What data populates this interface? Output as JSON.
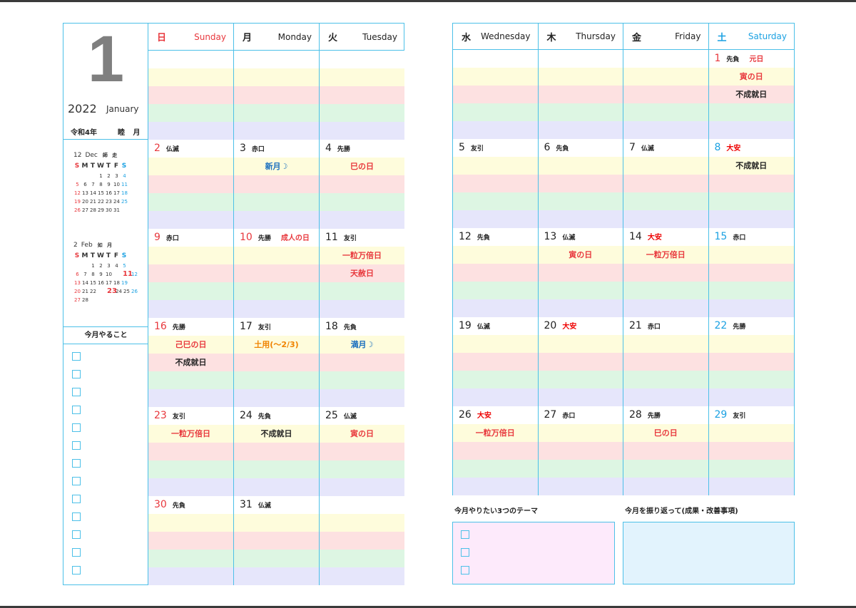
{
  "month_number": "1",
  "year": "2022",
  "month_en": "January",
  "wareki_year": "令和4年",
  "old_month_name": "睦 月",
  "dow": [
    {
      "jp": "日",
      "en": "Sunday"
    },
    {
      "jp": "月",
      "en": "Monday"
    },
    {
      "jp": "火",
      "en": "Tuesday"
    },
    {
      "jp": "水",
      "en": "Wednesday"
    },
    {
      "jp": "木",
      "en": "Thursday"
    },
    {
      "jp": "金",
      "en": "Friday"
    },
    {
      "jp": "土",
      "en": "Saturday"
    }
  ],
  "mini_calendars": [
    {
      "num": "12",
      "abbr": "Dec",
      "old_name": "師 走",
      "dow_letters": [
        "S",
        "M",
        "T",
        "W",
        "T",
        "F",
        "S"
      ],
      "weeks": [
        [
          "",
          "",
          "",
          "1",
          "2",
          "3",
          "4"
        ],
        [
          "5",
          "6",
          "7",
          "8",
          "9",
          "10",
          "11"
        ],
        [
          "12",
          "13",
          "14",
          "15",
          "16",
          "17",
          "18"
        ],
        [
          "19",
          "20",
          "21",
          "22",
          "23",
          "24",
          "25"
        ],
        [
          "26",
          "27",
          "28",
          "29",
          "30",
          "31",
          ""
        ]
      ],
      "holidays": []
    },
    {
      "num": "2",
      "abbr": "Feb",
      "old_name": "如 月",
      "dow_letters": [
        "S",
        "M",
        "T",
        "W",
        "T",
        "F",
        "S"
      ],
      "weeks": [
        [
          "",
          "",
          "1",
          "2",
          "3",
          "4",
          "5"
        ],
        [
          "6",
          "7",
          "8",
          "9",
          "10",
          "11",
          "12"
        ],
        [
          "13",
          "14",
          "15",
          "16",
          "17",
          "18",
          "19"
        ],
        [
          "20",
          "21",
          "22",
          "23",
          "24",
          "25",
          "26"
        ],
        [
          "27",
          "28",
          "",
          "",
          "",
          "",
          ""
        ]
      ],
      "holidays": [
        "11",
        "23"
      ]
    }
  ],
  "todo_title": "今月やること",
  "todo_count": 13,
  "left_weeks": [
    [
      {
        "num": "",
        "rokuyo": "",
        "holiday": "",
        "events": []
      },
      {
        "num": "",
        "rokuyo": "",
        "holiday": "",
        "events": []
      },
      {
        "num": "",
        "rokuyo": "",
        "holiday": "",
        "events": []
      }
    ],
    [
      {
        "num": "2",
        "rokuyo": "仏滅",
        "holiday": "",
        "events": []
      },
      {
        "num": "3",
        "rokuyo": "赤口",
        "holiday": "",
        "events": [
          {
            "text": "新月☽",
            "color": "blue"
          }
        ]
      },
      {
        "num": "4",
        "rokuyo": "先勝",
        "holiday": "",
        "events": [
          {
            "text": "巳の日",
            "color": "red"
          }
        ]
      }
    ],
    [
      {
        "num": "9",
        "rokuyo": "赤口",
        "holiday": "",
        "events": []
      },
      {
        "num": "10",
        "rokuyo": "先勝",
        "holiday": "成人の日",
        "events": []
      },
      {
        "num": "11",
        "rokuyo": "友引",
        "holiday": "",
        "events": [
          {
            "text": "一粒万倍日",
            "color": "red"
          },
          {
            "text": "天赦日",
            "color": "red"
          }
        ]
      }
    ],
    [
      {
        "num": "16",
        "rokuyo": "先勝",
        "holiday": "",
        "events": [
          {
            "text": "己巳の日",
            "color": "red"
          },
          {
            "text": "不成就日",
            "color": "black"
          }
        ]
      },
      {
        "num": "17",
        "rokuyo": "友引",
        "holiday": "",
        "events": [
          {
            "text": "土用(～2/3)",
            "color": "orange"
          }
        ]
      },
      {
        "num": "18",
        "rokuyo": "先負",
        "holiday": "",
        "events": [
          {
            "text": "満月☽",
            "color": "blue"
          }
        ]
      }
    ],
    [
      {
        "num": "23",
        "rokuyo": "友引",
        "holiday": "",
        "events": [
          {
            "text": "一粒万倍日",
            "color": "red"
          }
        ]
      },
      {
        "num": "24",
        "rokuyo": "先負",
        "holiday": "",
        "events": [
          {
            "text": "不成就日",
            "color": "black"
          }
        ]
      },
      {
        "num": "25",
        "rokuyo": "仏滅",
        "holiday": "",
        "events": [
          {
            "text": "寅の日",
            "color": "red"
          }
        ]
      }
    ],
    [
      {
        "num": "30",
        "rokuyo": "先負",
        "holiday": "",
        "events": []
      },
      {
        "num": "31",
        "rokuyo": "仏滅",
        "holiday": "",
        "events": []
      },
      {
        "num": "",
        "rokuyo": "",
        "holiday": "",
        "events": []
      }
    ]
  ],
  "right_weeks": [
    [
      {
        "num": "",
        "rokuyo": "",
        "holiday": "",
        "events": []
      },
      {
        "num": "",
        "rokuyo": "",
        "holiday": "",
        "events": []
      },
      {
        "num": "",
        "rokuyo": "",
        "holiday": "",
        "events": []
      },
      {
        "num": "1",
        "rokuyo": "先負",
        "holiday": "元日",
        "events": [
          {
            "text": "寅の日",
            "color": "red"
          },
          {
            "text": "不成就日",
            "color": "black"
          }
        ]
      }
    ],
    [
      {
        "num": "5",
        "rokuyo": "友引",
        "holiday": "",
        "events": []
      },
      {
        "num": "6",
        "rokuyo": "先負",
        "holiday": "",
        "events": []
      },
      {
        "num": "7",
        "rokuyo": "仏滅",
        "holiday": "",
        "events": []
      },
      {
        "num": "8",
        "rokuyo": "大安",
        "holiday": "",
        "events": [
          {
            "text": "不成就日",
            "color": "black"
          }
        ]
      }
    ],
    [
      {
        "num": "12",
        "rokuyo": "先負",
        "holiday": "",
        "events": []
      },
      {
        "num": "13",
        "rokuyo": "仏滅",
        "holiday": "",
        "events": [
          {
            "text": "寅の日",
            "color": "red"
          }
        ]
      },
      {
        "num": "14",
        "rokuyo": "大安",
        "holiday": "",
        "events": [
          {
            "text": "一粒万倍日",
            "color": "red"
          }
        ]
      },
      {
        "num": "15",
        "rokuyo": "赤口",
        "holiday": "",
        "events": []
      }
    ],
    [
      {
        "num": "19",
        "rokuyo": "仏滅",
        "holiday": "",
        "events": []
      },
      {
        "num": "20",
        "rokuyo": "大安",
        "holiday": "",
        "events": []
      },
      {
        "num": "21",
        "rokuyo": "赤口",
        "holiday": "",
        "events": []
      },
      {
        "num": "22",
        "rokuyo": "先勝",
        "holiday": "",
        "events": []
      }
    ],
    [
      {
        "num": "26",
        "rokuyo": "大安",
        "holiday": "",
        "events": [
          {
            "text": "一粒万倍日",
            "color": "red"
          }
        ]
      },
      {
        "num": "27",
        "rokuyo": "赤口",
        "holiday": "",
        "events": []
      },
      {
        "num": "28",
        "rokuyo": "先勝",
        "holiday": "",
        "events": [
          {
            "text": "巳の日",
            "color": "red"
          }
        ]
      },
      {
        "num": "29",
        "rokuyo": "友引",
        "holiday": "",
        "events": []
      }
    ]
  ],
  "theme_title": "今月やりたい3つのテーマ",
  "theme_count": 3,
  "review_title": "今月を振り返って(成果・改善事項)"
}
